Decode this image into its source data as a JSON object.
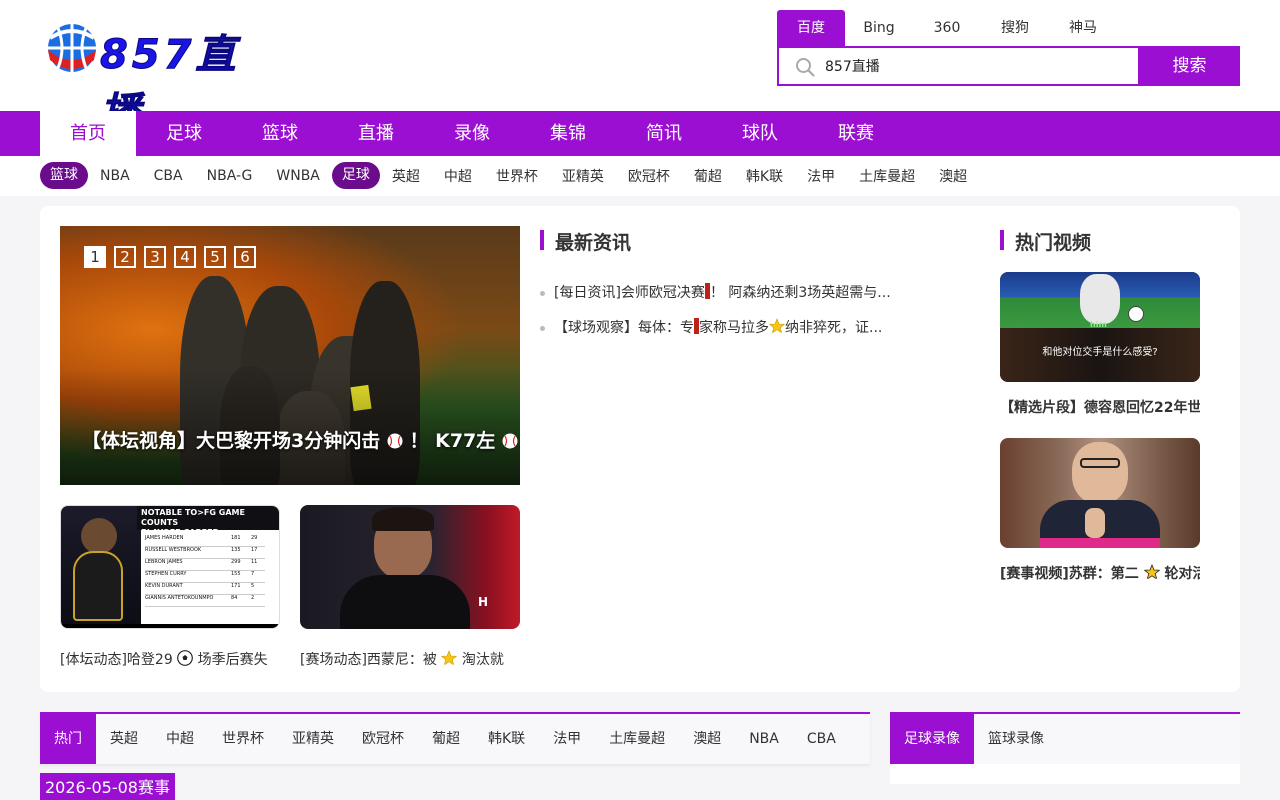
{
  "brand": {
    "logo_text": "857直播",
    "accent": "#9b0fd3"
  },
  "search": {
    "engines": [
      "百度",
      "Bing",
      "360",
      "搜狗",
      "神马"
    ],
    "active_engine": "百度",
    "value": "857直播",
    "button": "搜索"
  },
  "mainnav": [
    "首页",
    "足球",
    "篮球",
    "直播",
    "录像",
    "集锦",
    "简讯",
    "球队",
    "联赛"
  ],
  "subnav": {
    "basketball_pill": "篮球",
    "basketball": [
      "NBA",
      "CBA",
      "NBA-G",
      "WNBA"
    ],
    "football_pill": "足球",
    "football": [
      "英超",
      "中超",
      "世界杯",
      "亚精英",
      "欧冠杯",
      "葡超",
      "韩K联",
      "法甲",
      "土库曼超",
      "澳超"
    ]
  },
  "hero": {
    "caption_a": "【体坛视角】大巴黎开场3分钟闪击",
    "caption_b": "！ K77左",
    "dots": [
      "1",
      "2",
      "3",
      "4",
      "5",
      "6"
    ]
  },
  "cards": [
    {
      "title_a": "[体坛动态]哈登29",
      "title_b": "场季后赛失"
    },
    {
      "title_a": "[赛场动态]西蒙尼：被",
      "title_b": "淘汰就"
    }
  ],
  "card_table": {
    "title_line1": "NOTABLE TO>FG GAME COUNTS",
    "title_line2": "PLAYOFF CAREER",
    "rows": [
      [
        "JAMES HARDEN",
        "181",
        "29"
      ],
      [
        "RUSSELL WESTBROOK",
        "135",
        "17"
      ],
      [
        "LEBRON JAMES",
        "299",
        "11"
      ],
      [
        "STEPHEN CURRY",
        "155",
        "7"
      ],
      [
        "KEVIN DURANT",
        "171",
        "5"
      ],
      [
        "GIANNIS ANTETOKOUNMPO",
        "84",
        "2"
      ]
    ]
  },
  "news": {
    "title": "最新资讯",
    "items": [
      {
        "a": "[每日资讯]会师欧冠决赛",
        "b": "！ 阿森纳还剩3场英超需与..."
      },
      {
        "a": "【球场观察】每体：专",
        "b": "家称马拉多",
        "c": "纳非猝死，证..."
      }
    ]
  },
  "videos": {
    "title": "热门视频",
    "items": [
      {
        "title": "【精选片段】德容恩回忆22年世",
        "subtitle": "和他对位交手是什么感受?",
        "tag": "him"
      },
      {
        "title_a": "[赛事视频]苏群：第二",
        "title_b": "轮对活"
      }
    ]
  },
  "tabs_left": [
    "热门",
    "英超",
    "中超",
    "世界杯",
    "亚精英",
    "欧冠杯",
    "葡超",
    "韩K联",
    "法甲",
    "土库曼超",
    "澳超",
    "NBA",
    "CBA"
  ],
  "tabs_right": [
    "足球录像",
    "篮球录像"
  ],
  "date_tag": "2026-05-08赛事"
}
